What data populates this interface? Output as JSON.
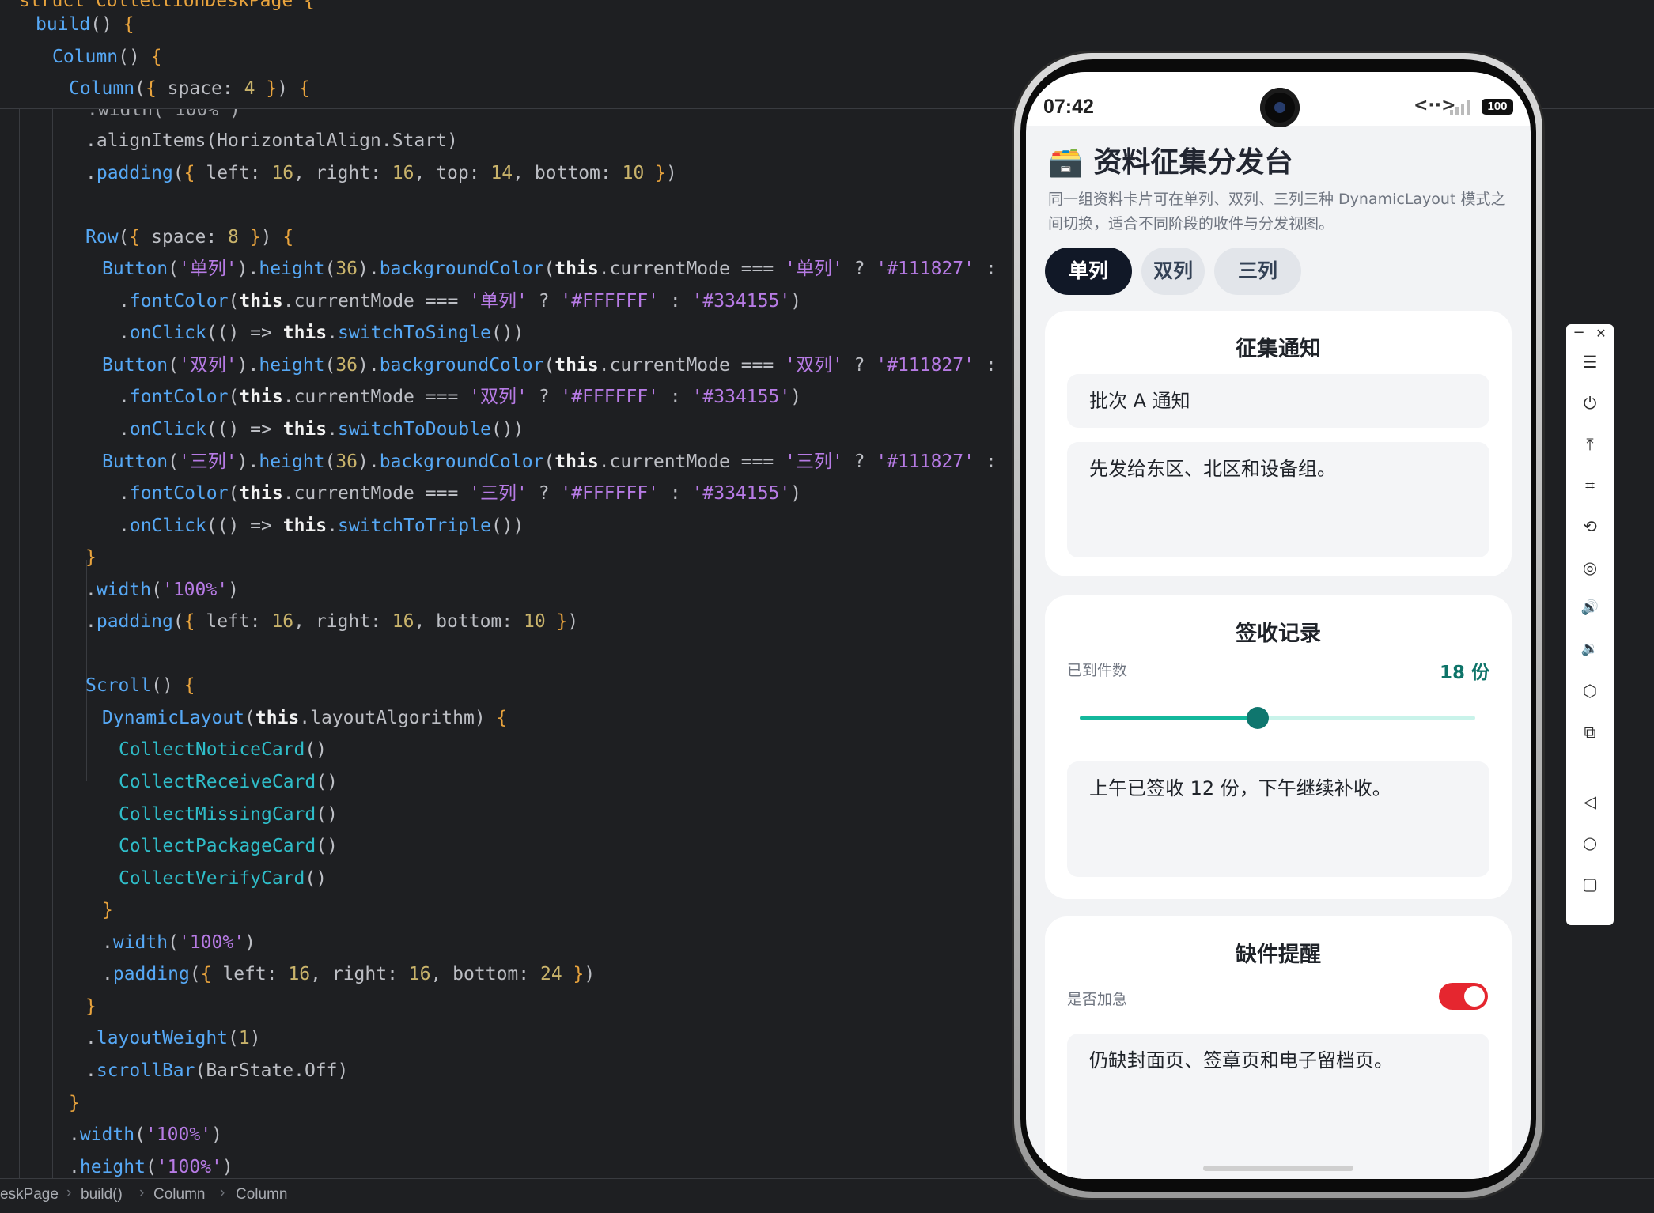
{
  "editor": {
    "struct_header": "struct CollectionDeskPage {",
    "code_top": [
      [
        [
          "t-fn",
          "build"
        ],
        [
          "t-op",
          "() "
        ],
        [
          "t-br",
          "{"
        ]
      ],
      [
        [
          "t-fn",
          "Column"
        ],
        [
          "t-op",
          "() "
        ],
        [
          "t-br",
          "{"
        ]
      ],
      [
        [
          "t-fn",
          "Column"
        ],
        [
          "t-op",
          "("
        ],
        [
          "t-br",
          "{"
        ],
        [
          "t-op",
          " space: "
        ],
        [
          "t-num",
          "4"
        ],
        [
          "t-op",
          " "
        ],
        [
          "t-br",
          "}"
        ],
        [
          "t-op",
          ") "
        ],
        [
          "t-br",
          "{"
        ]
      ]
    ],
    "code_lines": [
      {
        "indent": 4,
        "tokens": [
          [
            "t-op",
            ".alignItems("
          ],
          [
            "t-op",
            "HorizontalAlign.Start"
          ],
          [
            "t-op",
            ")"
          ]
        ]
      },
      {
        "indent": 4,
        "tokens": [
          [
            "t-op",
            "."
          ],
          [
            "t-fn",
            "padding"
          ],
          [
            "t-op",
            "("
          ],
          [
            "t-br",
            "{"
          ],
          [
            "t-op",
            " left: "
          ],
          [
            "t-num",
            "16"
          ],
          [
            "t-op",
            ", right: "
          ],
          [
            "t-num",
            "16"
          ],
          [
            "t-op",
            ", top: "
          ],
          [
            "t-num",
            "14"
          ],
          [
            "t-op",
            ", bottom: "
          ],
          [
            "t-num",
            "10"
          ],
          [
            "t-op",
            " "
          ],
          [
            "t-br",
            "}"
          ],
          [
            "t-op",
            ")"
          ]
        ]
      },
      {
        "indent": 0,
        "tokens": []
      },
      {
        "indent": 4,
        "tokens": [
          [
            "t-fn",
            "Row"
          ],
          [
            "t-op",
            "("
          ],
          [
            "t-br",
            "{"
          ],
          [
            "t-op",
            " space: "
          ],
          [
            "t-num",
            "8"
          ],
          [
            "t-op",
            " "
          ],
          [
            "t-br",
            "}"
          ],
          [
            "t-op",
            ") "
          ],
          [
            "t-br",
            "{"
          ]
        ]
      },
      {
        "indent": 5,
        "tokens": [
          [
            "t-fn",
            "Button"
          ],
          [
            "t-op",
            "("
          ],
          [
            "t-str",
            "'单列'"
          ],
          [
            "t-op",
            ")."
          ],
          [
            "t-fn",
            "height"
          ],
          [
            "t-op",
            "("
          ],
          [
            "t-num",
            "36"
          ],
          [
            "t-op",
            ")."
          ],
          [
            "t-fn",
            "backgroundColor"
          ],
          [
            "t-op",
            "("
          ],
          [
            "t-kw",
            "this"
          ],
          [
            "t-op",
            ".currentMode === "
          ],
          [
            "t-str",
            "'单列'"
          ],
          [
            "t-op",
            " ? "
          ],
          [
            "t-str",
            "'#111827'"
          ],
          [
            "t-op",
            " :"
          ]
        ]
      },
      {
        "indent": 6,
        "tokens": [
          [
            "t-op",
            "."
          ],
          [
            "t-fn",
            "fontColor"
          ],
          [
            "t-op",
            "("
          ],
          [
            "t-kw",
            "this"
          ],
          [
            "t-op",
            ".currentMode === "
          ],
          [
            "t-str",
            "'单列'"
          ],
          [
            "t-op",
            " ? "
          ],
          [
            "t-str",
            "'#FFFFFF'"
          ],
          [
            "t-op",
            " : "
          ],
          [
            "t-str",
            "'#334155'"
          ],
          [
            "t-op",
            ")"
          ]
        ]
      },
      {
        "indent": 6,
        "tokens": [
          [
            "t-op",
            "."
          ],
          [
            "t-fn",
            "onClick"
          ],
          [
            "t-op",
            "(() => "
          ],
          [
            "t-kw",
            "this"
          ],
          [
            "t-op",
            "."
          ],
          [
            "t-fn",
            "switchToSingle"
          ],
          [
            "t-op",
            "())"
          ]
        ]
      },
      {
        "indent": 5,
        "tokens": [
          [
            "t-fn",
            "Button"
          ],
          [
            "t-op",
            "("
          ],
          [
            "t-str",
            "'双列'"
          ],
          [
            "t-op",
            ")."
          ],
          [
            "t-fn",
            "height"
          ],
          [
            "t-op",
            "("
          ],
          [
            "t-num",
            "36"
          ],
          [
            "t-op",
            ")."
          ],
          [
            "t-fn",
            "backgroundColor"
          ],
          [
            "t-op",
            "("
          ],
          [
            "t-kw",
            "this"
          ],
          [
            "t-op",
            ".currentMode === "
          ],
          [
            "t-str",
            "'双列'"
          ],
          [
            "t-op",
            " ? "
          ],
          [
            "t-str",
            "'#111827'"
          ],
          [
            "t-op",
            " :"
          ]
        ]
      },
      {
        "indent": 6,
        "tokens": [
          [
            "t-op",
            "."
          ],
          [
            "t-fn",
            "fontColor"
          ],
          [
            "t-op",
            "("
          ],
          [
            "t-kw",
            "this"
          ],
          [
            "t-op",
            ".currentMode === "
          ],
          [
            "t-str",
            "'双列'"
          ],
          [
            "t-op",
            " ? "
          ],
          [
            "t-str",
            "'#FFFFFF'"
          ],
          [
            "t-op",
            " : "
          ],
          [
            "t-str",
            "'#334155'"
          ],
          [
            "t-op",
            ")"
          ]
        ]
      },
      {
        "indent": 6,
        "tokens": [
          [
            "t-op",
            "."
          ],
          [
            "t-fn",
            "onClick"
          ],
          [
            "t-op",
            "(() => "
          ],
          [
            "t-kw",
            "this"
          ],
          [
            "t-op",
            "."
          ],
          [
            "t-fn",
            "switchToDouble"
          ],
          [
            "t-op",
            "())"
          ]
        ]
      },
      {
        "indent": 5,
        "tokens": [
          [
            "t-fn",
            "Button"
          ],
          [
            "t-op",
            "("
          ],
          [
            "t-str",
            "'三列'"
          ],
          [
            "t-op",
            ")."
          ],
          [
            "t-fn",
            "height"
          ],
          [
            "t-op",
            "("
          ],
          [
            "t-num",
            "36"
          ],
          [
            "t-op",
            ")."
          ],
          [
            "t-fn",
            "backgroundColor"
          ],
          [
            "t-op",
            "("
          ],
          [
            "t-kw",
            "this"
          ],
          [
            "t-op",
            ".currentMode === "
          ],
          [
            "t-str",
            "'三列'"
          ],
          [
            "t-op",
            " ? "
          ],
          [
            "t-str",
            "'#111827'"
          ],
          [
            "t-op",
            " :"
          ]
        ]
      },
      {
        "indent": 6,
        "tokens": [
          [
            "t-op",
            "."
          ],
          [
            "t-fn",
            "fontColor"
          ],
          [
            "t-op",
            "("
          ],
          [
            "t-kw",
            "this"
          ],
          [
            "t-op",
            ".currentMode === "
          ],
          [
            "t-str",
            "'三列'"
          ],
          [
            "t-op",
            " ? "
          ],
          [
            "t-str",
            "'#FFFFFF'"
          ],
          [
            "t-op",
            " : "
          ],
          [
            "t-str",
            "'#334155'"
          ],
          [
            "t-op",
            ")"
          ]
        ]
      },
      {
        "indent": 6,
        "tokens": [
          [
            "t-op",
            "."
          ],
          [
            "t-fn",
            "onClick"
          ],
          [
            "t-op",
            "(() => "
          ],
          [
            "t-kw",
            "this"
          ],
          [
            "t-op",
            "."
          ],
          [
            "t-fn",
            "switchToTriple"
          ],
          [
            "t-op",
            "())"
          ]
        ]
      },
      {
        "indent": 4,
        "tokens": [
          [
            "t-br",
            "}"
          ]
        ]
      },
      {
        "indent": 4,
        "tokens": [
          [
            "t-op",
            "."
          ],
          [
            "t-fn",
            "width"
          ],
          [
            "t-op",
            "("
          ],
          [
            "t-str",
            "'100%'"
          ],
          [
            "t-op",
            ")"
          ]
        ]
      },
      {
        "indent": 4,
        "tokens": [
          [
            "t-op",
            "."
          ],
          [
            "t-fn",
            "padding"
          ],
          [
            "t-op",
            "("
          ],
          [
            "t-br",
            "{"
          ],
          [
            "t-op",
            " left: "
          ],
          [
            "t-num",
            "16"
          ],
          [
            "t-op",
            ", right: "
          ],
          [
            "t-num",
            "16"
          ],
          [
            "t-op",
            ", bottom: "
          ],
          [
            "t-num",
            "10"
          ],
          [
            "t-op",
            " "
          ],
          [
            "t-br",
            "}"
          ],
          [
            "t-op",
            ")"
          ]
        ]
      },
      {
        "indent": 0,
        "tokens": []
      },
      {
        "indent": 4,
        "tokens": [
          [
            "t-fn",
            "Scroll"
          ],
          [
            "t-op",
            "() "
          ],
          [
            "t-br",
            "{"
          ]
        ]
      },
      {
        "indent": 5,
        "tokens": [
          [
            "t-fn",
            "DynamicLayout"
          ],
          [
            "t-op",
            "("
          ],
          [
            "t-kw",
            "this"
          ],
          [
            "t-op",
            ".layoutAlgorithm) "
          ],
          [
            "t-br",
            "{"
          ]
        ]
      },
      {
        "indent": 6,
        "tokens": [
          [
            "t-type",
            "CollectNoticeCard"
          ],
          [
            "t-op",
            "()"
          ]
        ]
      },
      {
        "indent": 6,
        "tokens": [
          [
            "t-type",
            "CollectReceiveCard"
          ],
          [
            "t-op",
            "()"
          ]
        ]
      },
      {
        "indent": 6,
        "tokens": [
          [
            "t-type",
            "CollectMissingCard"
          ],
          [
            "t-op",
            "()"
          ]
        ]
      },
      {
        "indent": 6,
        "tokens": [
          [
            "t-type",
            "CollectPackageCard"
          ],
          [
            "t-op",
            "()"
          ]
        ]
      },
      {
        "indent": 6,
        "tokens": [
          [
            "t-type",
            "CollectVerifyCard"
          ],
          [
            "t-op",
            "()"
          ]
        ]
      },
      {
        "indent": 5,
        "tokens": [
          [
            "t-br",
            "}"
          ]
        ]
      },
      {
        "indent": 5,
        "tokens": [
          [
            "t-op",
            "."
          ],
          [
            "t-fn",
            "width"
          ],
          [
            "t-op",
            "("
          ],
          [
            "t-str",
            "'100%'"
          ],
          [
            "t-op",
            ")"
          ]
        ]
      },
      {
        "indent": 5,
        "tokens": [
          [
            "t-op",
            "."
          ],
          [
            "t-fn",
            "padding"
          ],
          [
            "t-op",
            "("
          ],
          [
            "t-br",
            "{"
          ],
          [
            "t-op",
            " left: "
          ],
          [
            "t-num",
            "16"
          ],
          [
            "t-op",
            ", right: "
          ],
          [
            "t-num",
            "16"
          ],
          [
            "t-op",
            ", bottom: "
          ],
          [
            "t-num",
            "24"
          ],
          [
            "t-op",
            " "
          ],
          [
            "t-br",
            "}"
          ],
          [
            "t-op",
            ")"
          ]
        ]
      },
      {
        "indent": 4,
        "tokens": [
          [
            "t-br",
            "}"
          ]
        ]
      },
      {
        "indent": 4,
        "tokens": [
          [
            "t-op",
            "."
          ],
          [
            "t-fn",
            "layoutWeight"
          ],
          [
            "t-op",
            "("
          ],
          [
            "t-num",
            "1"
          ],
          [
            "t-op",
            ")"
          ]
        ]
      },
      {
        "indent": 4,
        "tokens": [
          [
            "t-op",
            "."
          ],
          [
            "t-fn",
            "scrollBar"
          ],
          [
            "t-op",
            "(BarState.Off)"
          ]
        ]
      },
      {
        "indent": 3,
        "tokens": [
          [
            "t-br",
            "}"
          ]
        ]
      },
      {
        "indent": 3,
        "tokens": [
          [
            "t-op",
            "."
          ],
          [
            "t-fn",
            "width"
          ],
          [
            "t-op",
            "("
          ],
          [
            "t-str",
            "'100%'"
          ],
          [
            "t-op",
            ")"
          ]
        ]
      },
      {
        "indent": 3,
        "tokens": [
          [
            "t-op",
            "."
          ],
          [
            "t-fn",
            "height"
          ],
          [
            "t-op",
            "("
          ],
          [
            "t-str",
            "'100%'"
          ],
          [
            "t-op",
            ")"
          ]
        ]
      }
    ],
    "clipped_line": ".width('100%')",
    "breadcrumb": [
      "eskPage",
      "build()",
      "Column",
      "Column"
    ]
  },
  "phone": {
    "status": {
      "time": "07:42",
      "net": "<··>",
      "battery": "100"
    },
    "title": "🗃️ 资料征集分发台",
    "subtitle": "同一组资料卡片可在单列、双列、三列三种 DynamicLayout 模式之间切换，适合不同阶段的收件与分发视图。",
    "modes": [
      "单列",
      "双列",
      "三列"
    ],
    "active_mode": "单列",
    "cards": {
      "notice": {
        "title": "征集通知",
        "field1": "批次 A 通知",
        "field2": "先发给东区、北区和设备组。"
      },
      "receive": {
        "title": "签收记录",
        "label": "已到件数",
        "count": "18 份",
        "slider_value": 0.45,
        "note": "上午已签收 12 份，下午继续补收。"
      },
      "missing": {
        "title": "缺件提醒",
        "label": "是否加急",
        "toggle_on": true,
        "note": "仍缺封面页、签章页和电子留档页。"
      }
    }
  },
  "colors": {
    "active_button": "#111827",
    "inactive_text": "#334155",
    "accent_teal": "#0f766e",
    "toggle_red": "#e5262f"
  },
  "toolbar": {
    "icons": [
      "minimize-icon",
      "close-icon",
      "menu-icon",
      "power-icon",
      "pin-top-icon",
      "crop-icon",
      "rotate-icon",
      "screenshot-icon",
      "volume-up-icon",
      "volume-down-icon",
      "shake-icon",
      "multi-device-icon",
      "back-icon",
      "home-icon",
      "recents-icon"
    ],
    "glyphs": {
      "minimize": "−",
      "close": "✕",
      "menu": "☰",
      "power": "⏻",
      "pin": "⤒",
      "crop": "⌗",
      "rotate": "⟲",
      "screenshot": "◎",
      "volup": "🔊",
      "voldown": "🔉",
      "shake": "⬡",
      "multi": "⧉",
      "back": "◁",
      "home": "○",
      "recents": "▢"
    }
  }
}
